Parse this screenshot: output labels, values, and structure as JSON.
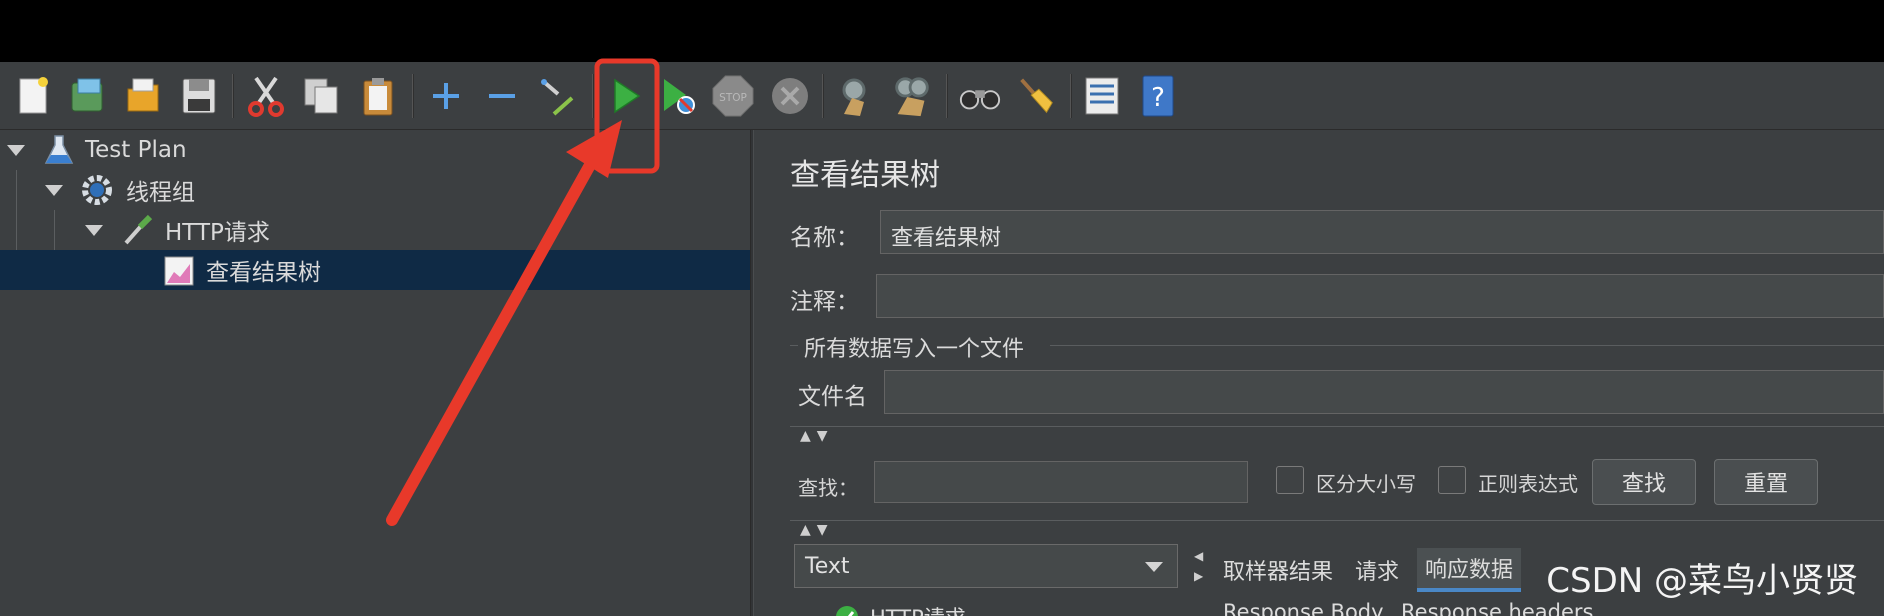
{
  "tree": {
    "items": [
      {
        "label": "Test Plan",
        "icon": "flask-icon"
      },
      {
        "label": "线程组",
        "icon": "gear-icon"
      },
      {
        "label": "HTTP请求",
        "icon": "pipette-icon"
      },
      {
        "label": "查看结果树",
        "icon": "chart-icon"
      }
    ]
  },
  "panel": {
    "title": "查看结果树",
    "name_label": "名称：",
    "name_value": "查看结果树",
    "comment_label": "注释：",
    "comment_value": "",
    "file_group_label": "所有数据写入一个文件",
    "filename_label": "文件名",
    "filename_value": "",
    "search_label": "查找：",
    "search_value": "",
    "case_sensitive_label": "区分大小写",
    "regex_label": "正则表达式",
    "find_button": "查找",
    "reset_button": "重置",
    "renderer_selected": "Text",
    "result_item": "HTTP请求",
    "tabs": [
      "取样器结果",
      "请求",
      "响应数据"
    ],
    "active_tab": "响应数据",
    "subtabs": [
      "Response Body",
      "Response headers"
    ]
  },
  "toolbar": {
    "stop_badge": "STOP",
    "help_badge": "?"
  },
  "watermark": "CSDN @菜鸟小贤贤",
  "colors": {
    "annotation_red": "#e8392a",
    "run_green": "#3cb043",
    "selection_blue": "#0f2a45",
    "tab_underline": "#4a88c7"
  }
}
